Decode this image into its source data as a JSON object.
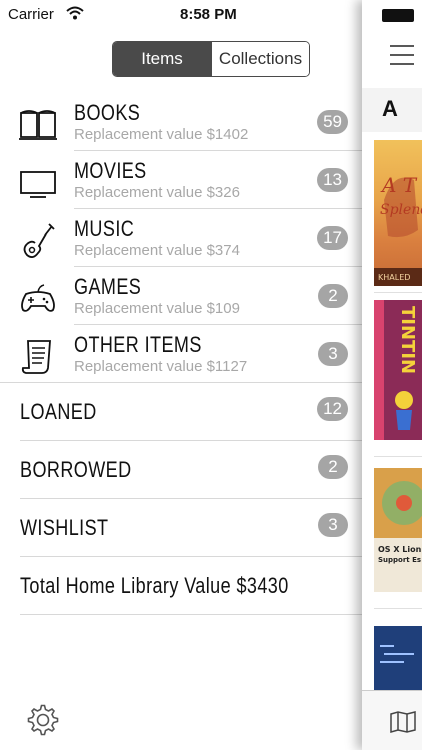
{
  "status_bar": {
    "carrier": "Carrier",
    "time": "8:58 PM"
  },
  "segmented": {
    "items_label": "Items",
    "collections_label": "Collections"
  },
  "categories": [
    {
      "title": "BOOKS",
      "subtitle": "Replacement value $1402",
      "count": "59",
      "icon": "book-icon"
    },
    {
      "title": "MOVIES",
      "subtitle": "Replacement value $326",
      "count": "13",
      "icon": "tv-icon"
    },
    {
      "title": "MUSIC",
      "subtitle": "Replacement value $374",
      "count": "17",
      "icon": "guitar-icon"
    },
    {
      "title": "GAMES",
      "subtitle": "Replacement value $109",
      "count": "2",
      "icon": "gamepad-icon"
    },
    {
      "title": "OTHER ITEMS",
      "subtitle": "Replacement value $1127",
      "count": "3",
      "icon": "scroll-icon"
    }
  ],
  "lists": [
    {
      "title": "LOANED",
      "count": "12"
    },
    {
      "title": "BORROWED",
      "count": "2"
    },
    {
      "title": "WISHLIST",
      "count": "3"
    }
  ],
  "total": {
    "label": "Total Home Library Value $3430"
  },
  "right_panel": {
    "section_letter": "A"
  },
  "colors": {
    "badge": "#a5a5a5",
    "segment_active": "#4a4a4a",
    "subtitle": "#a8a8a8"
  }
}
